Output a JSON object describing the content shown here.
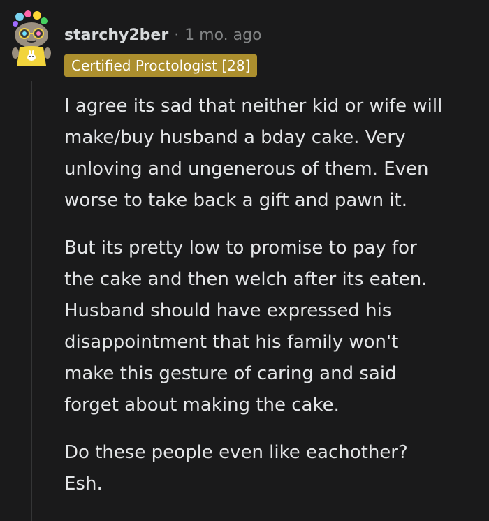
{
  "comment": {
    "username": "starchy2ber",
    "separator": "·",
    "timestamp": "1 mo. ago",
    "flair": "Certified Proctologist [28]",
    "paragraphs": [
      [
        "I agree its sad that neither kid or wife will",
        "make/buy husband a bday cake. Very",
        "unloving and ungenerous of them. Even",
        "worse to take back a gift and pawn it."
      ],
      [
        "But its pretty low to promise to pay for",
        "the cake and then welch after its eaten.",
        "Husband should have expressed his",
        "disappointment that his family won't",
        "make this gesture of caring and said",
        "forget about making the cake."
      ],
      [
        "Do these people even like eachother?",
        "Esh."
      ]
    ]
  },
  "colors": {
    "background": "#1a1a1b",
    "text": "#d7dadc",
    "muted": "#818384",
    "flair_bg": "#ac8f2e",
    "thread_line": "#343536"
  },
  "icons": {
    "avatar": "snoo-avatar-icon"
  }
}
